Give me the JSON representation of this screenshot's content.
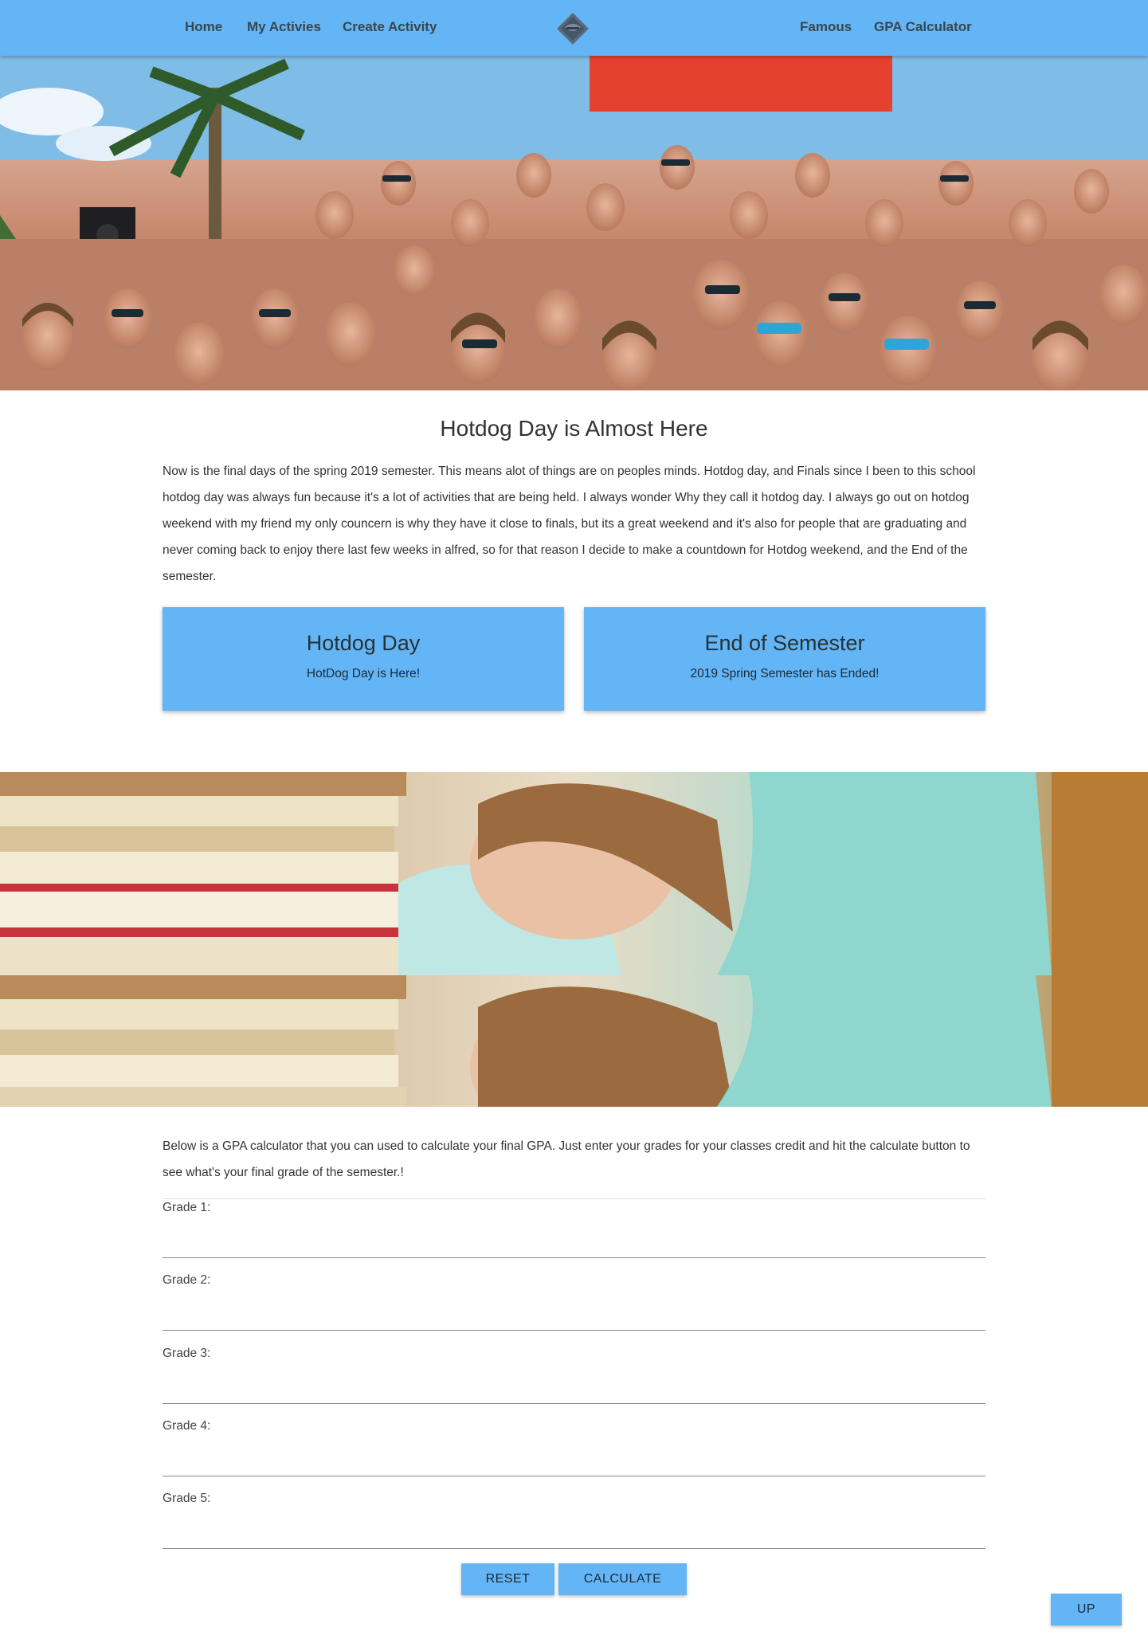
{
  "nav": {
    "home": "Home",
    "my_activities": "My Activies",
    "create_activity": "Create Activity",
    "famous": "Famous",
    "gpa_calculator": "GPA Calculator",
    "logo_icon": "diamond-logo-icon"
  },
  "hero": {
    "image": "crowd-party-photo"
  },
  "intro": {
    "title": "Hotdog Day is Almost Here",
    "paragraph": "Now is the final days of the spring 2019 semester. This means alot of things are on peoples minds. Hotdog day, and Finals since I been to this school hotdog day was always fun because it's a lot of activities that are being held. I always wonder Why they call it hotdog day. I always go out on hotdog weekend with my friend my only councern is why they have it close to finals, but its a great weekend and it's also for people that are graduating and never coming back to enjoy there last few weeks in alfred, so for that reason I decide to make a countdown for Hotdog weekend, and the End of the semester."
  },
  "cards": [
    {
      "title": "Hotdog Day",
      "text": "HotDog Day is Here!"
    },
    {
      "title": "End of Semester",
      "text": "2019 Spring Semester has Ended!"
    }
  ],
  "study_banner": {
    "image": "sleeping-student-books-photo"
  },
  "gpa": {
    "intro": "Below is a GPA calculator that you can used to calculate your final GPA. Just enter your grades for your classes credit and hit the calculate button to see what's your final grade of the semester.!",
    "grades": [
      {
        "label": "Grade 1:",
        "value": ""
      },
      {
        "label": "Grade 2:",
        "value": ""
      },
      {
        "label": "Grade 3:",
        "value": ""
      },
      {
        "label": "Grade 4:",
        "value": ""
      },
      {
        "label": "Grade 5:",
        "value": ""
      }
    ],
    "reset_label": "RESET",
    "calculate_label": "CALCULATE"
  },
  "up_label": "UP",
  "colors": {
    "accent": "#64b5f6",
    "text": "#333333"
  }
}
